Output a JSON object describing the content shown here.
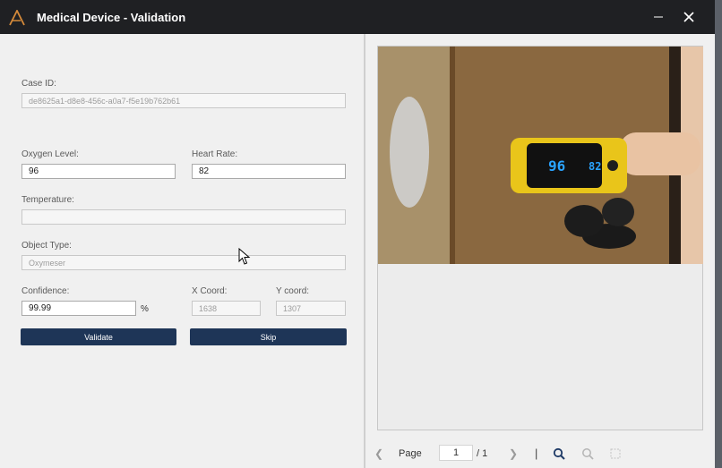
{
  "window": {
    "title": "Medical Device - Validation",
    "colors": {
      "titlebar": "#1f2023",
      "logo": "#d58a3a",
      "button": "#1e3557"
    }
  },
  "form": {
    "case_id": {
      "label": "Case ID:",
      "value": "de8625a1-d8e8-456c-a0a7-f5e19b762b61"
    },
    "oxygen_level": {
      "label": "Oxygen Level:",
      "value": "96"
    },
    "heart_rate": {
      "label": "Heart Rate:",
      "value": "82"
    },
    "temperature": {
      "label": "Temperature:",
      "value": ""
    },
    "object_type": {
      "label": "Object Type:",
      "value": "Oxymeser"
    },
    "confidence": {
      "label": "Confidence:",
      "value": "99.99",
      "unit": "%"
    },
    "x_coord": {
      "label": "X Coord:",
      "value": "1638"
    },
    "y_coord": {
      "label": "Y coord:",
      "value": "1307"
    },
    "validate_label": "Validate",
    "skip_label": "Skip"
  },
  "viewer": {
    "image_content": "pulse-oximeter-on-finger-photo",
    "display_spo2": "96",
    "display_hr": "82",
    "page_label": "Page",
    "page_current": "1",
    "page_total": "/ 1",
    "separator": "|",
    "icons": [
      "prev-page-icon",
      "next-page-icon",
      "zoom-in-icon",
      "zoom-out-icon",
      "fit-page-icon"
    ]
  }
}
